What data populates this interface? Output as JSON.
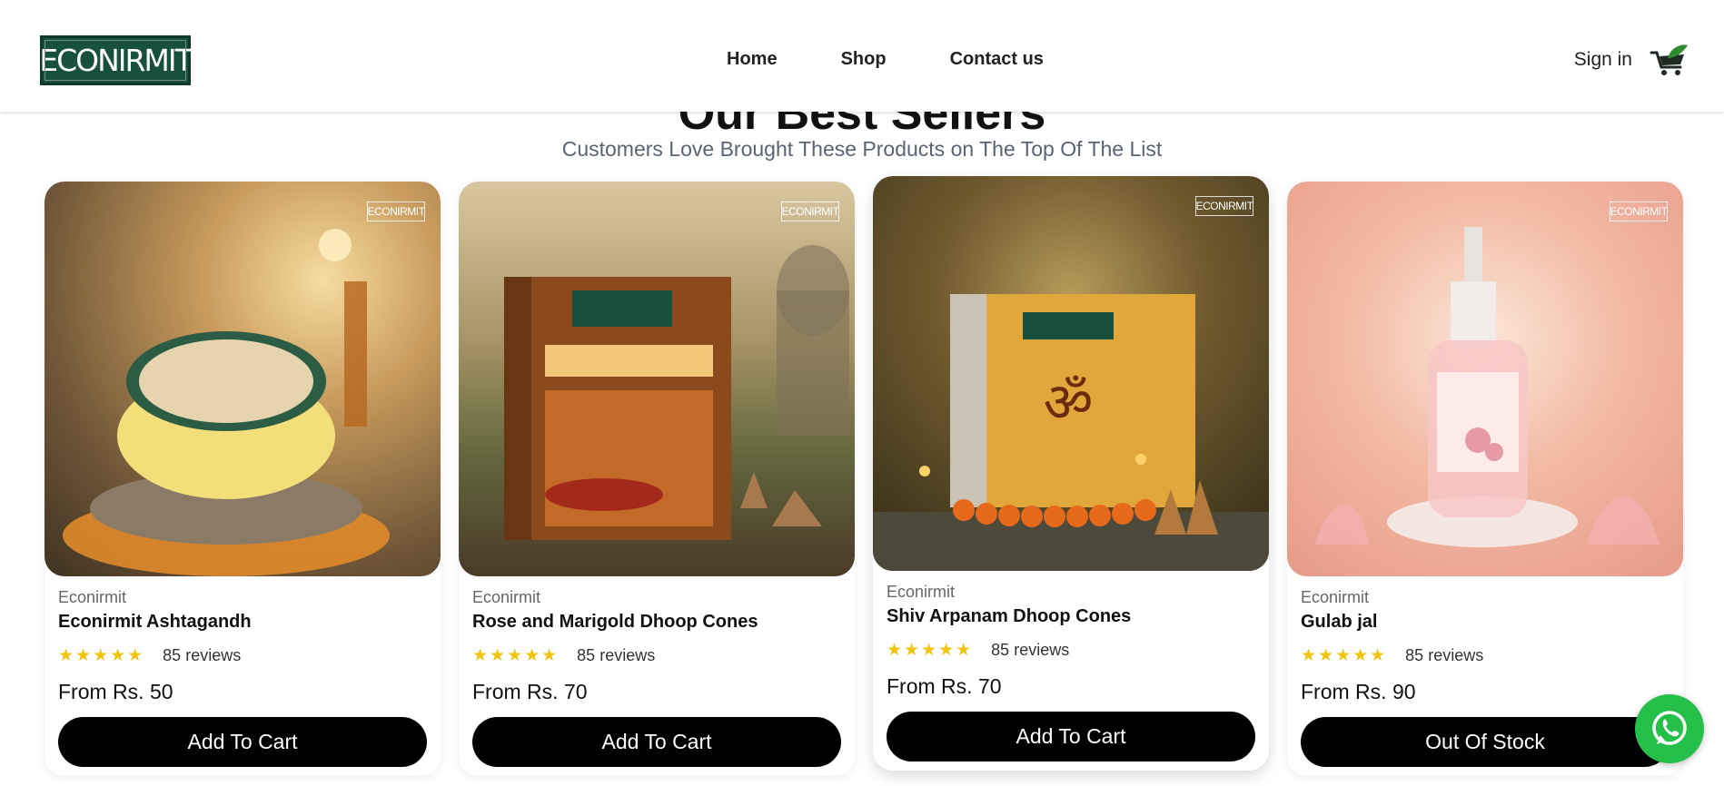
{
  "header": {
    "logo_text": "ECONIRMIT",
    "nav": [
      "Home",
      "Shop",
      "Contact us"
    ],
    "signin_label": "Sign in",
    "cart_icon": "cart-icon"
  },
  "section": {
    "title": "Our Best Sellers",
    "subtitle": "Customers Love Brought These Products on The Top Of The List"
  },
  "products": [
    {
      "brand": "Econirmit",
      "name": "Econirmit Ashtagandh",
      "stars": "★★★★★",
      "reviews": "85 reviews",
      "price": "From Rs. 50",
      "button": "Add To Cart",
      "image_logo": "ECONIRMIT"
    },
    {
      "brand": "Econirmit",
      "name": "Rose and Marigold Dhoop Cones",
      "stars": "★★★★★",
      "reviews": "85 reviews",
      "price": "From Rs. 70",
      "button": "Add To Cart",
      "image_logo": "ECONIRMIT"
    },
    {
      "brand": "Econirmit",
      "name": "Shiv Arpanam Dhoop Cones",
      "stars": "★★★★★",
      "reviews": "85 reviews",
      "price": "From Rs. 70",
      "button": "Add To Cart",
      "image_logo": "ECONIRMIT"
    },
    {
      "brand": "Econirmit",
      "name": "Gulab jal",
      "stars": "★★★★★",
      "reviews": "85 reviews",
      "price": "From Rs. 90",
      "button": "Out Of Stock",
      "image_logo": "ECONIRMIT"
    }
  ],
  "whatsapp": {
    "icon": "whatsapp-icon"
  },
  "colors": {
    "brand_green": "#17513e",
    "star": "#f1c40f",
    "button_bg": "#000000",
    "whatsapp": "#25c04a"
  }
}
